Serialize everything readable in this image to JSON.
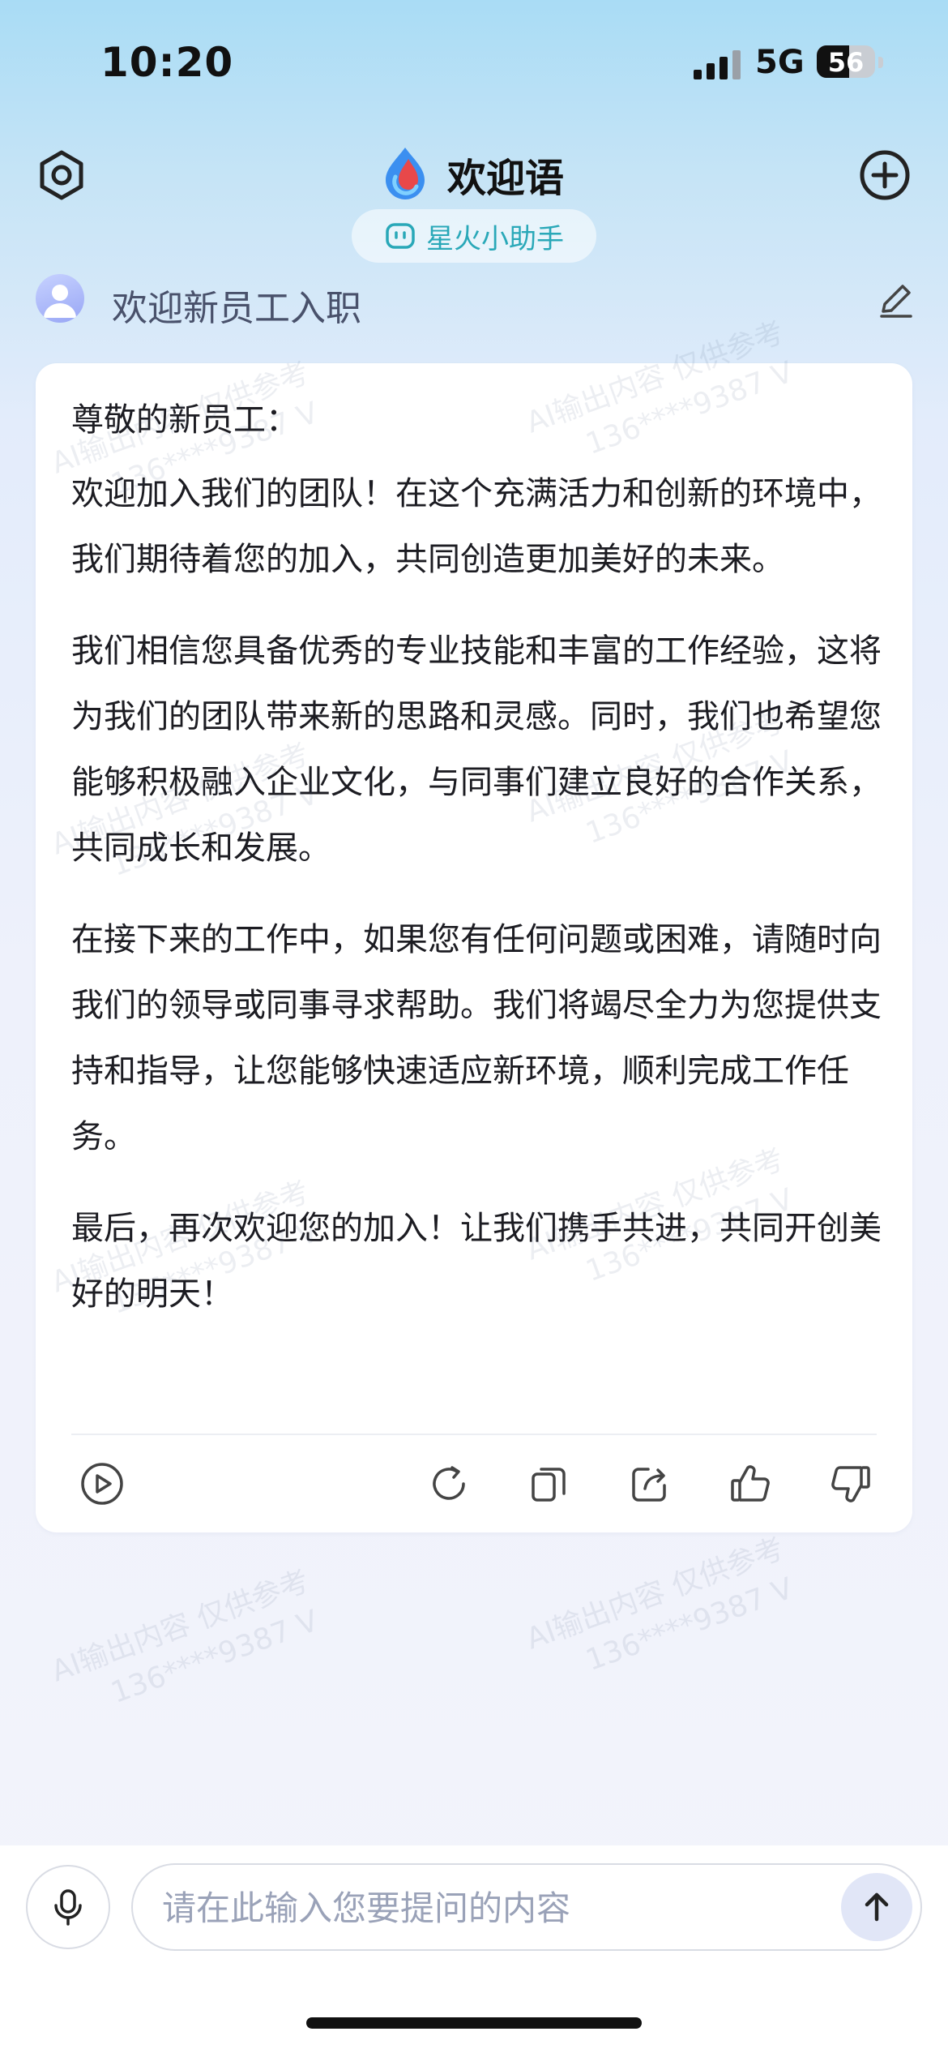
{
  "status_bar": {
    "time": "10:20",
    "network": "5G",
    "battery": "56",
    "battery_level": 0.56
  },
  "header": {
    "title": "欢迎语",
    "assistant_label": "星火小助手",
    "icons": {
      "settings": "settings-hex-icon",
      "add": "plus-circle-icon",
      "logo": "spark-logo-icon"
    }
  },
  "topic": {
    "title": "欢迎新员工入职"
  },
  "message": {
    "greeting": "尊敬的新员工：",
    "paragraphs": [
      "欢迎加入我们的团队！在这个充满活力和创新的环境中，我们期待着您的加入，共同创造更加美好的未来。",
      "我们相信您具备优秀的专业技能和丰富的工作经验，这将为我们的团队带来新的思路和灵感。同时，我们也希望您能够积极融入企业文化，与同事们建立良好的合作关系，共同成长和发展。",
      "在接下来的工作中，如果您有任何问题或困难，请随时向我们的领导或同事寻求帮助。我们将竭尽全力为您提供支持和指导，让您能够快速适应新环境，顺利完成工作任务。",
      "最后，再次欢迎您的加入！让我们携手共进，共同开创美好的明天！"
    ]
  },
  "watermark": {
    "line1": "AI输出内容 仅供参考",
    "line2": "136****9387 V"
  },
  "actions": [
    "play-icon",
    "regenerate-icon",
    "copy-icon",
    "share-icon",
    "thumbs-up-icon",
    "thumbs-down-icon"
  ],
  "input": {
    "placeholder": "请在此输入您要提问的内容"
  },
  "colors": {
    "accent": "#29a8b8",
    "send_bg": "#e1e6f7",
    "topic_text": "#49516b"
  }
}
